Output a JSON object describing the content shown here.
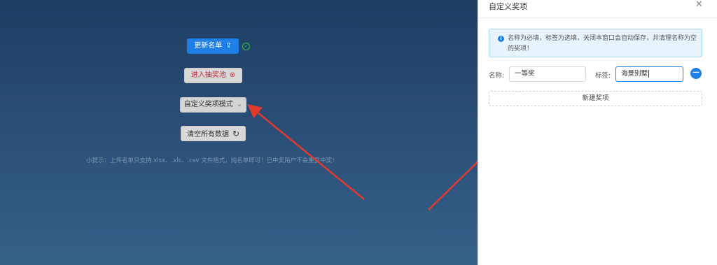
{
  "main": {
    "update_list_label": "更新名单",
    "enter_pool_label": "进入抽奖池",
    "custom_mode_label": "自定义奖项模式",
    "clear_data_label": "清空所有数据",
    "tip": "小提示：上传名单只支持.xlsx、.xls、.csv 文件格式，纯名单即可！已中奖用户不会重复中奖！"
  },
  "drawer": {
    "title": "自定义奖项",
    "close_glyph": "✕",
    "alert_text": "名称为必填，标签为选填，关闭本窗口会自动保存，并清理名称为空的奖项！",
    "name_label": "名称:",
    "name_value": "一等奖",
    "tag_label": "标签:",
    "tag_value": "海景别墅",
    "remove_glyph": "—",
    "new_item_label": "新建奖项"
  },
  "icons": {
    "upload": "upload-icon",
    "gift": "gift-icon",
    "chevron": "chevron-down-icon",
    "refresh": "refresh-icon",
    "check": "check-circle-icon",
    "info": "info-icon",
    "close": "close-icon"
  },
  "colors": {
    "primary": "#1e80e6",
    "danger": "#c8283a",
    "success": "#3cba4a",
    "annotation_arrow": "#e03a2e"
  }
}
